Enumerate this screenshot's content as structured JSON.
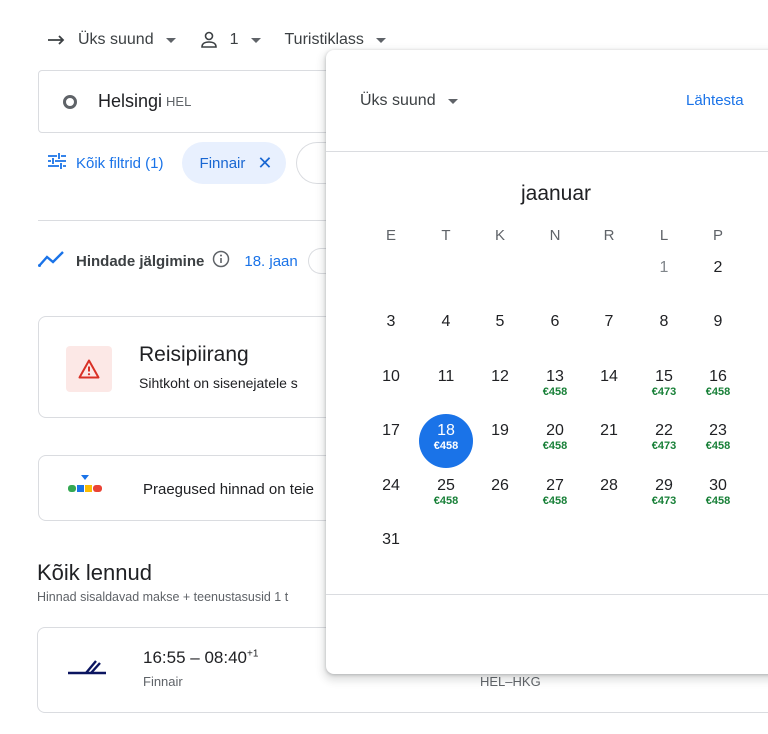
{
  "topbar": {
    "trip_type": "Üks suund",
    "passengers": "1",
    "cabin": "Turistiklass"
  },
  "origin": {
    "city": "Helsingi",
    "code": "HEL"
  },
  "filters": {
    "all_filters": "Kõik filtrid (1)",
    "airline_chip": "Finnair"
  },
  "tracking": {
    "label": "Hindade jälgimine",
    "date": "18. jaan"
  },
  "restriction": {
    "title": "Reisipiirang",
    "subtitle": "Sihtkoht on sisenejatele s"
  },
  "prices_card": {
    "text": "Praegused hinnad on teie"
  },
  "all_flights": {
    "title": "Kõik lennud",
    "subtitle": "Hinnad sisaldavad makse + teenustasusid 1 t"
  },
  "flight": {
    "time": "16:55 – 08:40",
    "day_offset": "+1",
    "airline": "Finnair",
    "route": "HEL–HKG"
  },
  "calendar": {
    "trip_type": "Üks suund",
    "reset": "Lähtesta",
    "month": "jaanuar",
    "weekdays": [
      "E",
      "T",
      "K",
      "N",
      "R",
      "L",
      "P"
    ],
    "days": [
      {
        "d": "1",
        "price": "",
        "muted": true
      },
      {
        "d": "2",
        "price": ""
      },
      {
        "d": "3",
        "price": ""
      },
      {
        "d": "4",
        "price": ""
      },
      {
        "d": "5",
        "price": ""
      },
      {
        "d": "6",
        "price": ""
      },
      {
        "d": "7",
        "price": ""
      },
      {
        "d": "8",
        "price": ""
      },
      {
        "d": "9",
        "price": ""
      },
      {
        "d": "10",
        "price": ""
      },
      {
        "d": "11",
        "price": ""
      },
      {
        "d": "12",
        "price": ""
      },
      {
        "d": "13",
        "price": "€458"
      },
      {
        "d": "14",
        "price": ""
      },
      {
        "d": "15",
        "price": "€473"
      },
      {
        "d": "16",
        "price": "€458"
      },
      {
        "d": "17",
        "price": ""
      },
      {
        "d": "18",
        "price": "€458",
        "selected": true
      },
      {
        "d": "19",
        "price": ""
      },
      {
        "d": "20",
        "price": "€458"
      },
      {
        "d": "21",
        "price": ""
      },
      {
        "d": "22",
        "price": "€473"
      },
      {
        "d": "23",
        "price": "€458"
      },
      {
        "d": "24",
        "price": ""
      },
      {
        "d": "25",
        "price": "€458"
      },
      {
        "d": "26",
        "price": ""
      },
      {
        "d": "27",
        "price": "€458"
      },
      {
        "d": "28",
        "price": ""
      },
      {
        "d": "29",
        "price": "€473"
      },
      {
        "d": "30",
        "price": "€458"
      },
      {
        "d": "31",
        "price": ""
      }
    ]
  },
  "colors": {
    "accent": "#1a73e8",
    "price_green": "#188038",
    "warning_red": "#d93025"
  }
}
